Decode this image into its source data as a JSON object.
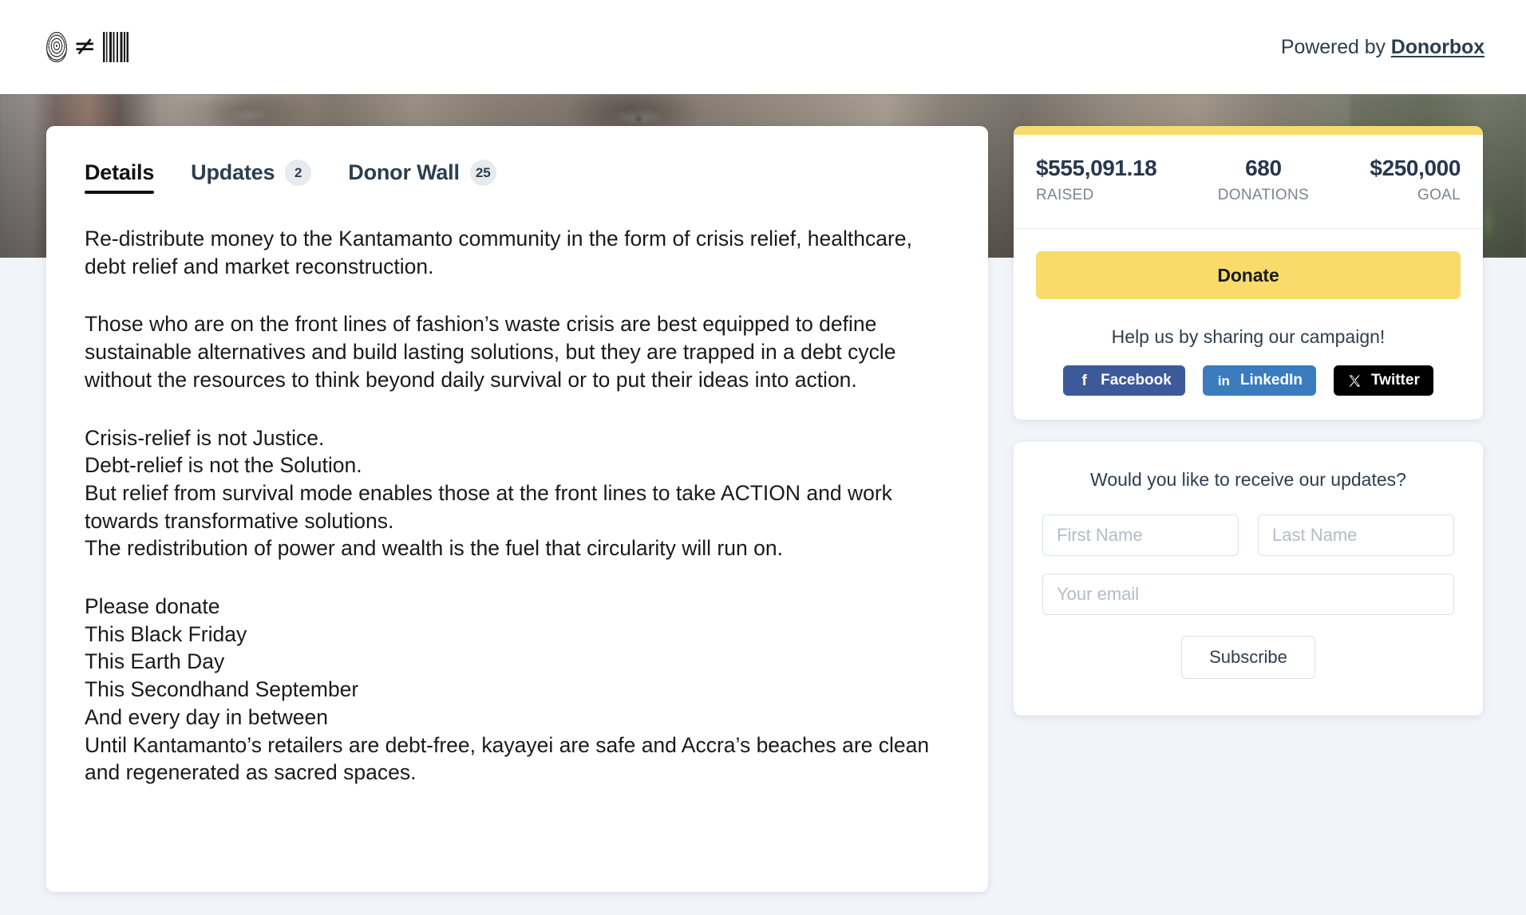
{
  "header": {
    "logo_icons": [
      "fingerprint-icon",
      "not-equal-icon",
      "barcode-icon"
    ],
    "not_equal_glyph": "≠",
    "powered_by_prefix": "Powered by ",
    "powered_by_link": "Donorbox"
  },
  "tabs": [
    {
      "label": "Details",
      "badge": "",
      "active": true
    },
    {
      "label": "Updates",
      "badge": "2",
      "active": false
    },
    {
      "label": "Donor Wall",
      "badge": "25",
      "active": false
    }
  ],
  "campaign": {
    "paragraph_1": [
      "Re-distribute money to the Kantamanto community in the form of crisis relief, healthcare, debt relief and market reconstruction."
    ],
    "paragraph_2": [
      "Those who are on the front lines of fashion’s waste crisis are best equipped to define sustainable alternatives and build lasting solutions, but they are trapped in a debt cycle without the resources to think beyond daily survival or to put their ideas into action."
    ],
    "paragraph_3": [
      "Crisis-relief is not Justice.",
      "Debt-relief is not the Solution.",
      "But relief from survival mode enables those at the front lines to take ACTION and work towards transformative solutions.",
      "The redistribution of power and wealth is the fuel that circularity will run on."
    ],
    "paragraph_4": [
      "Please donate",
      "This Black Friday",
      "This Earth Day",
      "This Secondhand September",
      "And every day in between",
      "Until Kantamanto’s retailers are debt-free, kayayei are safe and Accra’s beaches are clean and regenerated as sacred spaces."
    ]
  },
  "stats": {
    "raised_value": "$555,091.18",
    "raised_label": "RAISED",
    "donations_value": "680",
    "donations_label": "DONATIONS",
    "goal_value": "$250,000",
    "goal_label": "GOAL"
  },
  "donate": {
    "button_label": "Donate",
    "share_prompt": "Help us by sharing our campaign!",
    "share_buttons": [
      {
        "label": "Facebook",
        "icon": "facebook-icon",
        "glyph": "f",
        "color": "#3c5a99"
      },
      {
        "label": "LinkedIn",
        "icon": "linkedin-icon",
        "glyph": "in",
        "color": "#3a7cbd"
      },
      {
        "label": "Twitter",
        "icon": "twitter-x-icon",
        "glyph": "𝕏",
        "color": "#000000"
      }
    ]
  },
  "subscribe": {
    "title": "Would you like to receive our updates?",
    "first_name_placeholder": "First Name",
    "first_name_value": "",
    "last_name_placeholder": "Last Name",
    "last_name_value": "",
    "email_placeholder": "Your email",
    "email_value": "",
    "button_label": "Subscribe"
  },
  "colors": {
    "accent_yellow": "#f8db6b",
    "page_background": "#f1f5f9",
    "text_dark": "#2c3e50",
    "badge_background": "#e7eaee"
  }
}
